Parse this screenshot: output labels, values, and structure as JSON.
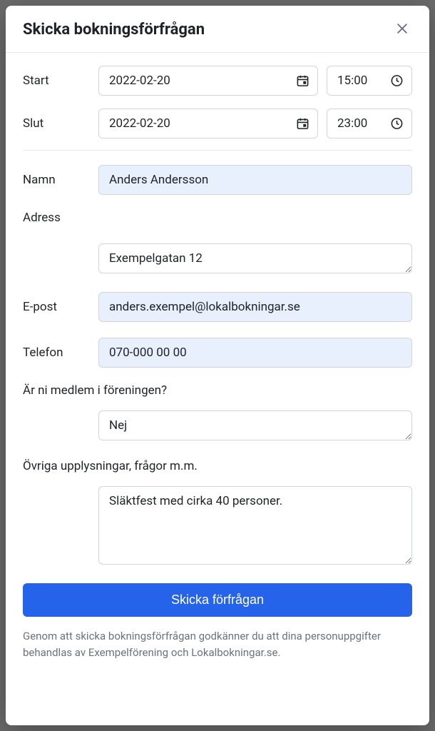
{
  "modal": {
    "title": "Skicka bokningsförfrågan"
  },
  "form": {
    "start_label": "Start",
    "start_date": "2022-02-20",
    "start_time": "15:00",
    "end_label": "Slut",
    "end_date": "2022-02-20",
    "end_time": "23:00",
    "name_label": "Namn",
    "name_value": "Anders Andersson",
    "address_label": "Adress",
    "address_value": "Exempelgatan 12",
    "email_label": "E-post",
    "email_value": "anders.exempel@lokalbokningar.se",
    "phone_label": "Telefon",
    "phone_value": "070-000 00 00",
    "member_label": "Är ni medlem i föreningen?",
    "member_value": "Nej",
    "notes_label": "Övriga upplysningar, frågor m.m.",
    "notes_value": "Släktfest med cirka 40 personer.",
    "submit_label": "Skicka förfrågan",
    "disclaimer": "Genom att skicka bokningsförfrågan godkänner du att dina personuppgifter behandlas av Exempelförening och Lokalbokningar.se."
  }
}
